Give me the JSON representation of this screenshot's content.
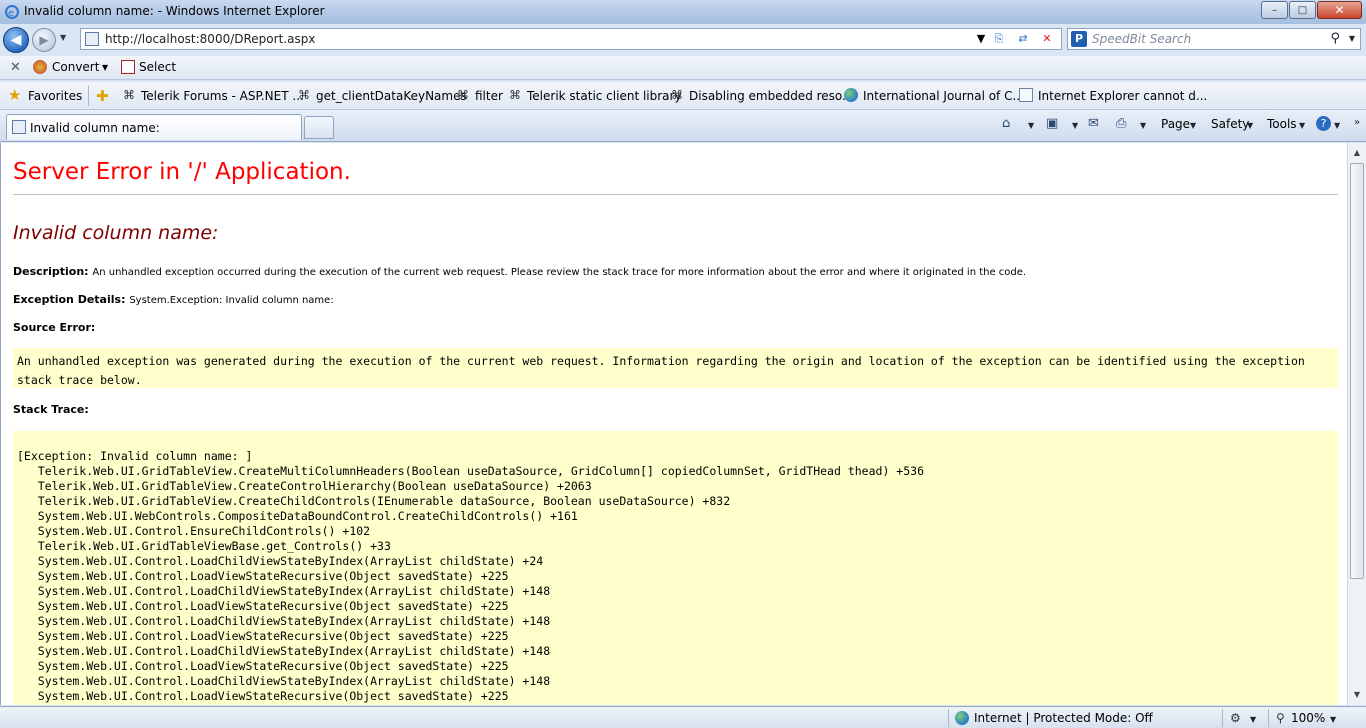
{
  "window": {
    "title": "Invalid column name: - Windows Internet Explorer",
    "minimize": "–",
    "maximize": "□",
    "close": "✕"
  },
  "address": {
    "url": "http://localhost:8000/DReport.aspx",
    "search_placeholder": "SpeedBit Search"
  },
  "command_bar": {
    "convert": "Convert",
    "select": "Select"
  },
  "favorites": {
    "label": "Favorites",
    "items": [
      "Telerik Forums - ASP.NET ...",
      "get_clientDataKeyNames",
      "filter",
      "Telerik static client library",
      "Disabling embedded reso...",
      "International Journal of C...",
      "Internet Explorer cannot d..."
    ]
  },
  "tab": {
    "title": "Invalid column name:"
  },
  "toolbar": {
    "page": "Page",
    "safety": "Safety",
    "tools": "Tools"
  },
  "page": {
    "heading": "Server Error in '/' Application.",
    "subheading": "Invalid column name:",
    "description_label": "Description:",
    "description_text": "An unhandled exception occurred during the execution of the current web request. Please review the stack trace for more information about the error and where it originated in the code.",
    "exception_label": "Exception Details:",
    "exception_text": "System.Exception: Invalid column name:",
    "source_error_label": "Source Error:",
    "source_error_text": "An unhandled exception was generated during the execution of the current web request. Information regarding the origin and location of the exception can be identified using the exception stack trace below.",
    "stack_trace_label": "Stack Trace:",
    "stack_trace": [
      "[Exception: Invalid column name: ]",
      "   Telerik.Web.UI.GridTableView.CreateMultiColumnHeaders(Boolean useDataSource, GridColumn[] copiedColumnSet, GridTHead thead) +536",
      "   Telerik.Web.UI.GridTableView.CreateControlHierarchy(Boolean useDataSource) +2063",
      "   Telerik.Web.UI.GridTableView.CreateChildControls(IEnumerable dataSource, Boolean useDataSource) +832",
      "   System.Web.UI.WebControls.CompositeDataBoundControl.CreateChildControls() +161",
      "   System.Web.UI.Control.EnsureChildControls() +102",
      "   Telerik.Web.UI.GridTableViewBase.get_Controls() +33",
      "   System.Web.UI.Control.LoadChildViewStateByIndex(ArrayList childState) +24",
      "   System.Web.UI.Control.LoadViewStateRecursive(Object savedState) +225",
      "   System.Web.UI.Control.LoadChildViewStateByIndex(ArrayList childState) +148",
      "   System.Web.UI.Control.LoadViewStateRecursive(Object savedState) +225",
      "   System.Web.UI.Control.LoadChildViewStateByIndex(ArrayList childState) +148",
      "   System.Web.UI.Control.LoadViewStateRecursive(Object savedState) +225",
      "   System.Web.UI.Control.LoadChildViewStateByIndex(ArrayList childState) +148",
      "   System.Web.UI.Control.LoadViewStateRecursive(Object savedState) +225",
      "   System.Web.UI.Control.LoadChildViewStateByIndex(ArrayList childState) +148",
      "   System.Web.UI.Control.LoadViewStateRecursive(Object savedState) +225"
    ]
  },
  "status": {
    "zone": "Internet | Protected Mode: Off",
    "zoom": "100%"
  }
}
